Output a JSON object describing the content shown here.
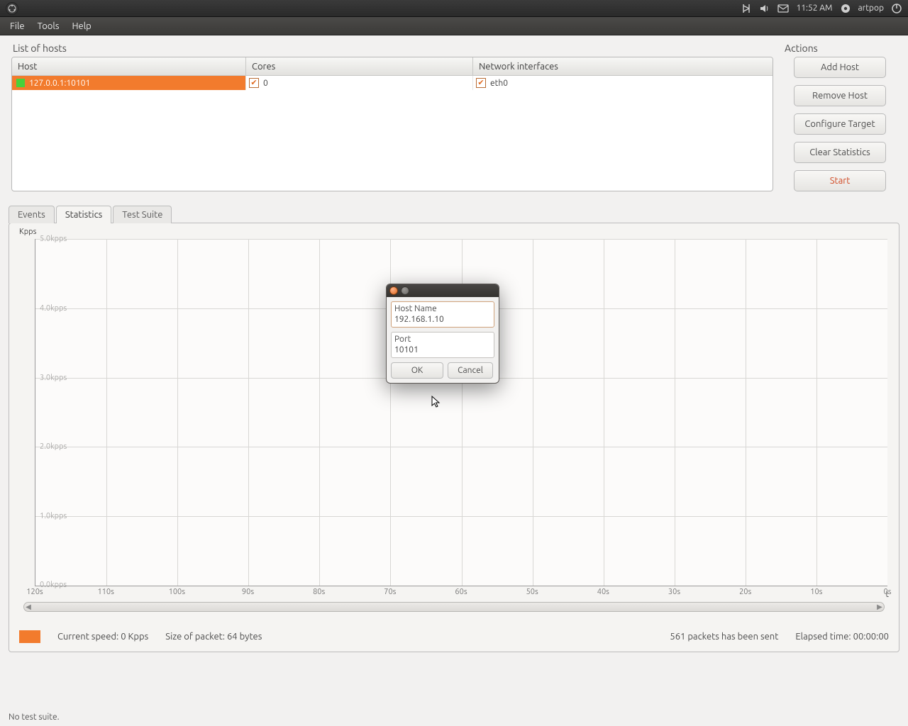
{
  "topbar": {
    "clock": "11:52 AM",
    "user": "artpop"
  },
  "menubar": {
    "items": [
      "File",
      "Tools",
      "Help"
    ]
  },
  "hosts_panel": {
    "title": "List of hosts",
    "columns": {
      "host": "Host",
      "cores": "Cores",
      "netif": "Network interfaces"
    },
    "rows": [
      {
        "host": "127.0.0.1:10101",
        "cores_label": "0",
        "netif_label": "eth0"
      }
    ]
  },
  "actions": {
    "title": "Actions",
    "add_host": "Add Host",
    "remove_host": "Remove Host",
    "configure_target": "Configure Target",
    "clear_statistics": "Clear Statistics",
    "start": "Start"
  },
  "tabs": {
    "events": "Events",
    "statistics": "Statistics",
    "test_suite": "Test Suite",
    "active": "statistics"
  },
  "chart_data": {
    "type": "line",
    "title": "",
    "xlabel": "t",
    "ylabel": "Kpps",
    "y_ticks": [
      "5.0kpps",
      "4.0kpps",
      "3.0kpps",
      "2.0kpps",
      "1.0kpps",
      "0.0kpps"
    ],
    "x_ticks": [
      "120s",
      "110s",
      "100s",
      "90s",
      "80s",
      "70s",
      "60s",
      "50s",
      "40s",
      "30s",
      "20s",
      "10s",
      "0s"
    ],
    "ylim": [
      0,
      5
    ],
    "series": [
      {
        "name": "",
        "values": []
      }
    ]
  },
  "status": {
    "current_speed_label": "Current speed:",
    "current_speed_value": "0 Kpps",
    "packet_size_label": "Size of packet:",
    "packet_size_value": "64 bytes",
    "packets_sent": "561 packets has been sent",
    "elapsed_label": "Elapsed time:",
    "elapsed_value": "00:00:00"
  },
  "bottom_status": "No test suite.",
  "dialog": {
    "host_label": "Host Name",
    "host_value": "192.168.1.10",
    "port_label": "Port",
    "port_value": "10101",
    "ok": "OK",
    "cancel": "Cancel"
  }
}
